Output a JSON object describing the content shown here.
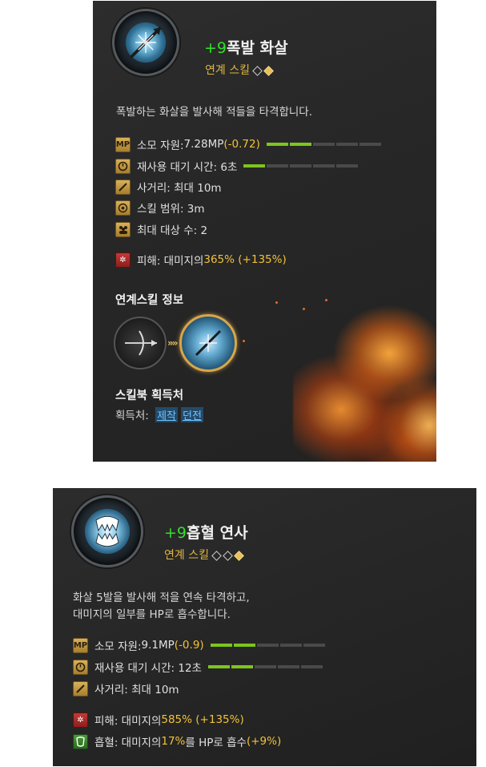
{
  "card1": {
    "level": "+9",
    "name": "폭발 화살",
    "type": "연계 스킬",
    "description": "폭발하는 화살을 발사해 적들을 타격합니다.",
    "stats": {
      "mp_label": "소모 자원: ",
      "mp_value": "7.28MP",
      "mp_delta": "(-0.72)",
      "mp_gauge": 2,
      "cooldown": "재사용 대기 시간: 6초",
      "cooldown_gauge": 1,
      "range": "사거리: 최대 10m",
      "area": "스킬 범위: 3m",
      "targets": "최대 대상 수: 2",
      "damage_label": "피해: 대미지의 ",
      "damage_value": "365%",
      "damage_delta": "(+135%)"
    },
    "combo_title": "연계스킬 정보",
    "source_title": "스킬북 획득처",
    "source_label": "획득처: ",
    "source_links": [
      "제작",
      "던전"
    ]
  },
  "card2": {
    "level": "+9",
    "name": "흡혈 연사",
    "type": "연계 스킬",
    "description_line1": "화살 5발을 발사해 적을 연속 타격하고,",
    "description_line2": "대미지의 일부를 HP로 흡수합니다.",
    "stats": {
      "mp_label": "소모 자원: ",
      "mp_value": "9.1MP",
      "mp_delta": "(-0.9)",
      "mp_gauge": 2,
      "cooldown": "재사용 대기 시간: 12초",
      "cooldown_gauge": 2,
      "range": "사거리: 최대 10m",
      "damage_label": "피해: 대미지의 ",
      "damage_value": "585%",
      "damage_delta": "(+135%)",
      "lifesteal_label": "흡혈: 대미지의 ",
      "lifesteal_value": "17%",
      "lifesteal_mid": "를 HP로 흡수 ",
      "lifesteal_delta": "(+9%)"
    }
  },
  "icons": {
    "mp": "MP",
    "cooldown": "cooldown-icon",
    "range": "range-icon",
    "area": "area-icon",
    "targets": "targets-icon",
    "damage": "damage-icon",
    "lifesteal": "lifesteal-icon"
  },
  "colors": {
    "level_green": "#33e02b",
    "type_gold": "#e0b640",
    "highlight_yellow": "#f2c23a",
    "gauge_green": "#7ec51d",
    "link_blue": "#6fc4ff"
  }
}
